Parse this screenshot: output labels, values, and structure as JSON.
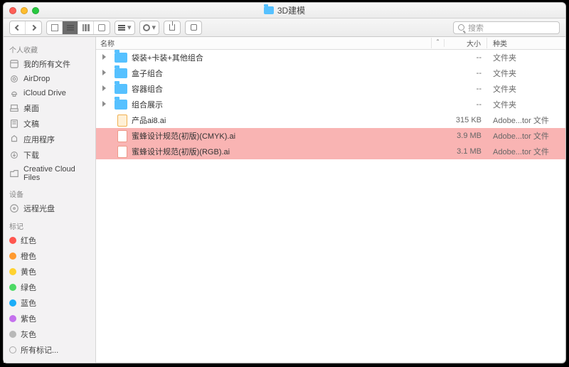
{
  "window": {
    "title": "3D建模"
  },
  "search": {
    "placeholder": "搜索"
  },
  "sidebar": {
    "favorites_label": "个人收藏",
    "devices_label": "设备",
    "tags_label": "标记",
    "favorites": [
      {
        "label": "我的所有文件"
      },
      {
        "label": "AirDrop"
      },
      {
        "label": "iCloud Drive"
      },
      {
        "label": "桌面"
      },
      {
        "label": "文稿"
      },
      {
        "label": "应用程序"
      },
      {
        "label": "下载"
      },
      {
        "label": "Creative Cloud Files"
      }
    ],
    "devices": [
      {
        "label": "远程光盘"
      }
    ],
    "tags": [
      {
        "label": "红色",
        "cls": "red"
      },
      {
        "label": "橙色",
        "cls": "orange"
      },
      {
        "label": "黄色",
        "cls": "yellow"
      },
      {
        "label": "绿色",
        "cls": "green"
      },
      {
        "label": "蓝色",
        "cls": "blue"
      },
      {
        "label": "紫色",
        "cls": "purple"
      },
      {
        "label": "灰色",
        "cls": "gray"
      },
      {
        "label": "所有标记...",
        "cls": "all"
      }
    ]
  },
  "columns": {
    "name": "名称",
    "sort": "ˆ",
    "size": "大小",
    "kind": "种类"
  },
  "rows": [
    {
      "name": "袋装+卡装+其他组合",
      "size": "--",
      "kind": "文件夹",
      "folder": true
    },
    {
      "name": "盒子组合",
      "size": "--",
      "kind": "文件夹",
      "folder": true
    },
    {
      "name": "容器组合",
      "size": "--",
      "kind": "文件夹",
      "folder": true
    },
    {
      "name": "组合展示",
      "size": "--",
      "kind": "文件夹",
      "folder": true
    },
    {
      "name": "产品ai8.ai",
      "size": "315 KB",
      "kind": "Adobe...tor 文件",
      "folder": false
    },
    {
      "name": "蜜蜂设计规范(初版)(CMYK).ai",
      "size": "3.9 MB",
      "kind": "Adobe...tor 文件",
      "folder": false,
      "tagged": true
    },
    {
      "name": "蜜蜂设计规范(初版)(RGB).ai",
      "size": "3.1 MB",
      "kind": "Adobe...tor 文件",
      "folder": false,
      "tagged": true
    }
  ]
}
